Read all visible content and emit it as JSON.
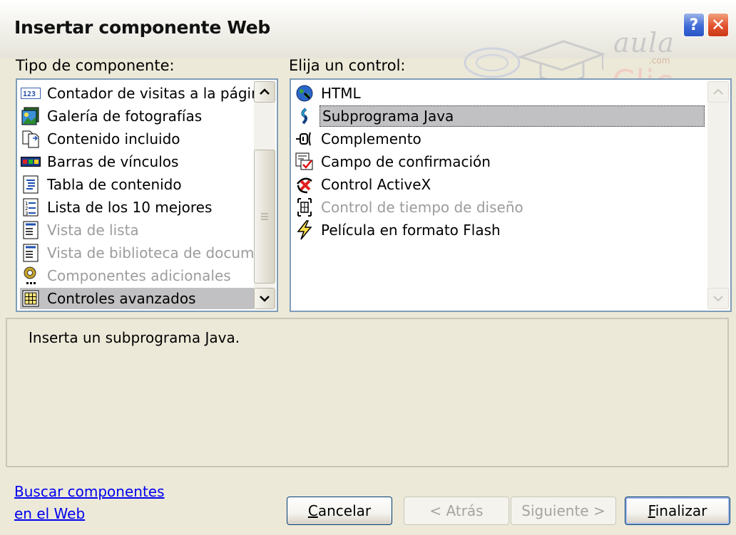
{
  "window": {
    "title": "Insertar componente Web",
    "help_label": "?",
    "close_label": "✕"
  },
  "logo": {
    "top": "aula",
    "com": ".com",
    "bottom": "Clic"
  },
  "left_panel": {
    "label": "Tipo de componente:",
    "items": [
      {
        "label": "Contador de visitas a la págir",
        "icon": "hit-counter-icon",
        "state": "normal"
      },
      {
        "label": "Galería de fotografías",
        "icon": "photo-gallery-icon",
        "state": "normal"
      },
      {
        "label": "Contenido incluido",
        "icon": "included-content-icon",
        "state": "normal"
      },
      {
        "label": "Barras de vínculos",
        "icon": "link-bars-icon",
        "state": "normal"
      },
      {
        "label": "Tabla de contenido",
        "icon": "table-of-contents-icon",
        "state": "normal"
      },
      {
        "label": "Lista de los 10 mejores",
        "icon": "top-ten-list-icon",
        "state": "normal"
      },
      {
        "label": "Vista de lista",
        "icon": "list-view-icon",
        "state": "disabled"
      },
      {
        "label": "Vista de biblioteca de docume",
        "icon": "document-library-icon",
        "state": "disabled"
      },
      {
        "label": "Componentes adicionales",
        "icon": "additional-components-icon",
        "state": "disabled"
      },
      {
        "label": "Controles avanzados",
        "icon": "advanced-controls-icon",
        "state": "selected"
      }
    ]
  },
  "right_panel": {
    "label": "Elija un control:",
    "items": [
      {
        "label": "HTML",
        "icon": "html-globe-icon",
        "state": "normal"
      },
      {
        "label": "Subprograma Java",
        "icon": "java-applet-icon",
        "state": "selected"
      },
      {
        "label": "Complemento",
        "icon": "plugin-icon",
        "state": "normal"
      },
      {
        "label": "Campo de confirmación",
        "icon": "confirmation-field-icon",
        "state": "normal"
      },
      {
        "label": "Control ActiveX",
        "icon": "activex-control-icon",
        "state": "normal"
      },
      {
        "label": "Control de tiempo de diseño",
        "icon": "design-time-control-icon",
        "state": "disabled"
      },
      {
        "label": "Película en formato Flash",
        "icon": "flash-movie-icon",
        "state": "normal"
      }
    ]
  },
  "description": "Inserta un subprograma Java.",
  "footer": {
    "link_line1": "Buscar componentes",
    "link_line2": "en el Web",
    "cancel": "Cancelar",
    "back": "< Atrás",
    "next": "Siguiente >",
    "finish": "Finalizar"
  }
}
